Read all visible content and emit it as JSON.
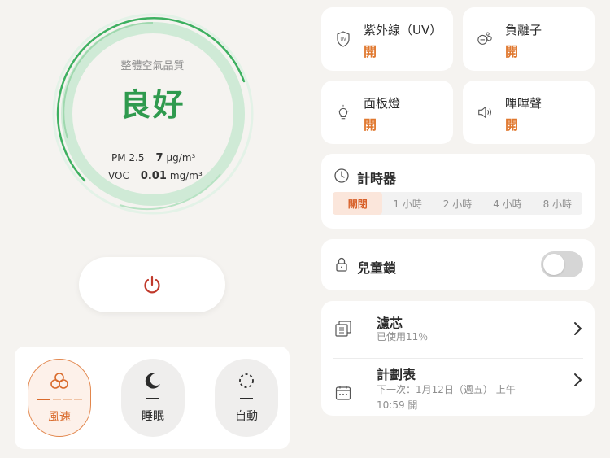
{
  "air_quality": {
    "title": "整體空氣品質",
    "status": "良好",
    "status_color": "#2f9a4e",
    "pm25": {
      "label": "PM 2.5",
      "value": "7",
      "unit": "μg/m³"
    },
    "voc": {
      "label": "VOC",
      "value": "0.01",
      "unit": "mg/m³"
    }
  },
  "power": {
    "icon": "power-icon"
  },
  "modes": [
    {
      "label": "風速",
      "icon": "fan-speed-icon",
      "active": true
    },
    {
      "label": "睡眠",
      "icon": "moon-icon",
      "active": false
    },
    {
      "label": "自動",
      "icon": "auto-icon",
      "active": false
    }
  ],
  "features": {
    "uv": {
      "title": "紫外線（UV）",
      "state": "開",
      "icon": "uv-shield-icon"
    },
    "ion": {
      "title": "負離子",
      "state": "開",
      "icon": "anion-icon"
    },
    "panel_light": {
      "title": "面板燈",
      "state": "開",
      "icon": "lightbulb-icon"
    },
    "beep": {
      "title": "嗶嗶聲",
      "state": "開",
      "icon": "speaker-icon"
    }
  },
  "timer": {
    "title": "計時器",
    "icon": "clock-icon",
    "options": [
      "關閉",
      "1 小時",
      "2 小時",
      "4 小時",
      "8 小時"
    ],
    "selected": "關閉"
  },
  "child_lock": {
    "title": "兒童鎖",
    "icon": "lock-icon",
    "enabled": false
  },
  "filter": {
    "title": "濾芯",
    "subtitle": "已使用11％",
    "icon": "filter-icon"
  },
  "schedule": {
    "title": "計劃表",
    "subtitle": "下一次：1月12日（週五） 上午 10:59 開",
    "icon": "calendar-icon"
  },
  "colors": {
    "accent": "#e0782f",
    "good": "#2f9a4e",
    "background": "#f5f3f0"
  }
}
